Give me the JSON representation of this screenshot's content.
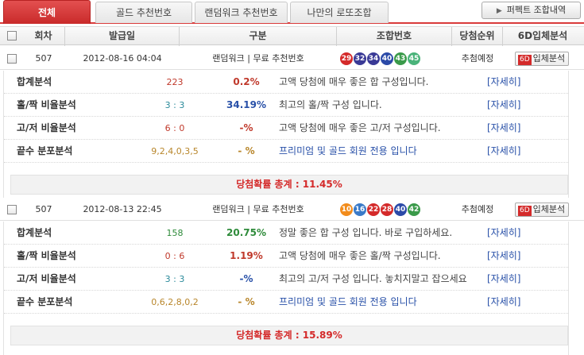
{
  "tabs": [
    {
      "label": "전체"
    },
    {
      "label": "골드 추천번호"
    },
    {
      "label": "랜덤워크 추천번호"
    },
    {
      "label": "나만의 로또조합"
    }
  ],
  "perfect_button": {
    "label": "퍼펙트 조합내역"
  },
  "headers": {
    "round": "회차",
    "issued": "발급일",
    "type": "구분",
    "combo": "조합번호",
    "rank": "당첨순위",
    "analysis": "6D입체분석"
  },
  "entries": [
    {
      "round": "507",
      "date": "2012-08-16 04:04",
      "type": "랜덤워크 | 무료 추천번호",
      "balls": [
        29,
        32,
        34,
        40,
        43,
        45
      ],
      "ball_colors": [
        "#d42a2a",
        "#3a3a96",
        "#3a3a96",
        "#2b4aa8",
        "#3a9a4a",
        "#4ab37a"
      ],
      "rank": "추첨예정",
      "analysis_badge": "6D",
      "analysis_label": "입체분석",
      "details": [
        {
          "label": "합계분석",
          "value": "223",
          "value_color": "#c0392b",
          "pct": "0.2%",
          "pct_color": "#c0392b",
          "msg": "고액 당첨에 매우 좋은 합 구성입니다.",
          "more": "[자세히]"
        },
        {
          "label": "홀/짝 비율분석",
          "value": "3 : 3",
          "value_color": "#2a8a9a",
          "pct": "34.19%",
          "pct_color": "#2850a8",
          "msg": "최고의 홀/짝 구성 입니다.",
          "more": "[자세히]"
        },
        {
          "label": "고/저 비율분석",
          "value": "6 : 0",
          "value_color": "#c0392b",
          "pct": "-%",
          "pct_color": "#c0392b",
          "msg": "고액 당첨에 매우 좋은 고/저 구성입니다.",
          "more": "[자세히]"
        },
        {
          "label": "끝수 분포분석",
          "value": "9,2,4,0,3,5",
          "value_color": "#b8862b",
          "pct": "- %",
          "pct_color": "#b8862b",
          "msg": "프리미엄 및 골드 회원 전용 입니다",
          "msg_color": "#2850a8",
          "more": "[자세히]"
        }
      ],
      "total": "당첨확률 총계 : 11.45%"
    },
    {
      "round": "507",
      "date": "2012-08-13 22:45",
      "type": "랜덤워크 | 무료 추천번호",
      "balls": [
        10,
        16,
        22,
        28,
        40,
        42
      ],
      "ball_colors": [
        "#f28c1c",
        "#3a7ac8",
        "#d42a2a",
        "#d42a2a",
        "#2b4aa8",
        "#3a9a4a"
      ],
      "rank": "추첨예정",
      "analysis_badge": "6D",
      "analysis_label": "입체분석",
      "details": [
        {
          "label": "합계분석",
          "value": "158",
          "value_color": "#2e8b3a",
          "pct": "20.75%",
          "pct_color": "#2e8b3a",
          "msg": "정말 좋은 합 구성 입니다. 바로 구입하세요.",
          "more": "[자세히]"
        },
        {
          "label": "홀/짝 비율분석",
          "value": "0 : 6",
          "value_color": "#c0392b",
          "pct": "1.19%",
          "pct_color": "#c0392b",
          "msg": "고액 당첨에 매우 좋은 홀/짝 구성입니다.",
          "more": "[자세히]"
        },
        {
          "label": "고/저 비율분석",
          "value": "3 : 3",
          "value_color": "#2a8a9a",
          "pct": "-%",
          "pct_color": "#2850a8",
          "msg": "최고의 고/저 구성 입니다. 놓치지말고 잡으세요",
          "more": "[자세히]"
        },
        {
          "label": "끝수 분포분석",
          "value": "0,6,2,8,0,2",
          "value_color": "#b8862b",
          "pct": "- %",
          "pct_color": "#b8862b",
          "msg": "프리미엄 및 골드 회원 전용 입니다",
          "msg_color": "#2850a8",
          "more": "[자세히]"
        }
      ],
      "total": "당첨확률 총계 : 15.89%"
    }
  ]
}
